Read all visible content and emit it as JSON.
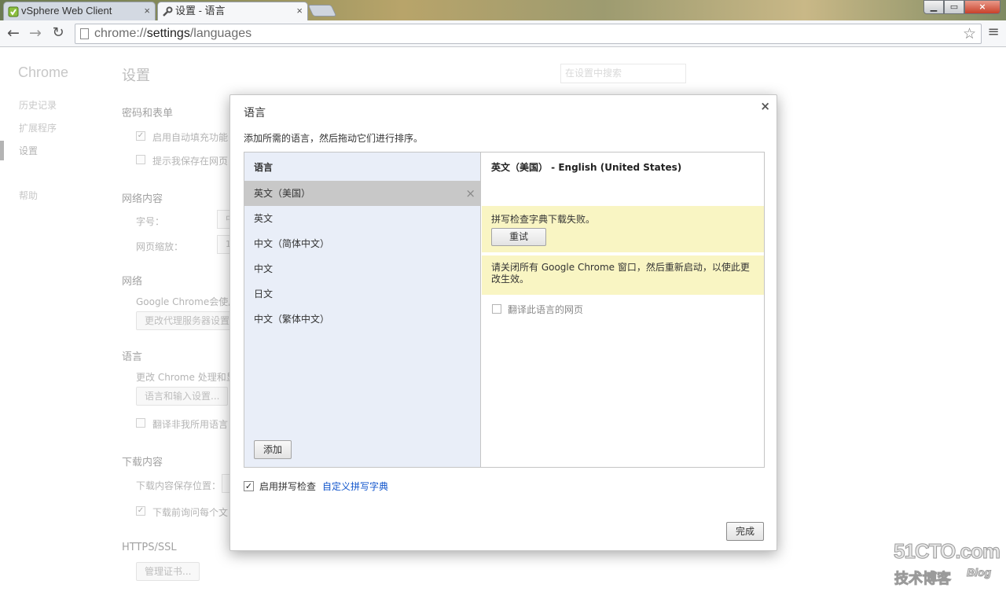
{
  "tabs": [
    {
      "title": "vSphere Web Client",
      "icon": "vsphere-icon",
      "close": "×"
    },
    {
      "title": "设置 - 语言",
      "icon": "wrench-icon",
      "close": "×"
    }
  ],
  "window": {
    "minimize": "▁",
    "maximize": "▭",
    "close": "×"
  },
  "toolbar": {
    "back": "←",
    "forward": "→",
    "reload": "↻",
    "url_scheme": "chrome://",
    "url_host": "settings",
    "url_path": "/languages",
    "star": "☆",
    "menu": "≡"
  },
  "sidebar": {
    "app_title": "Chrome",
    "items": [
      {
        "label": "历史记录"
      },
      {
        "label": "扩展程序"
      },
      {
        "label": "设置"
      },
      {
        "label": "帮助"
      }
    ]
  },
  "settings": {
    "title": "设置",
    "search_placeholder": "在设置中搜索",
    "passwords_title": "密码和表单",
    "autofill_label": "启用自动填充功能",
    "save_passwords_label": "提示我保存在网页",
    "web_content_title": "网络内容",
    "font_size_label": "字号：",
    "font_size_value": "中",
    "zoom_label": "网页缩放：",
    "zoom_value": "1",
    "network_title": "网络",
    "network_desc": "Google Chrome会使用",
    "proxy_button": "更改代理服务器设置",
    "languages_title": "语言",
    "languages_desc": "更改 Chrome 处理和显",
    "lang_input_button": "语言和输入设置...",
    "translate_label": "翻译非我所用语言",
    "downloads_title": "下载内容",
    "download_location_label": "下载内容保存位置：",
    "download_location_value": "D",
    "ask_download_label": "下载前询问每个文",
    "https_title": "HTTPS/SSL",
    "cert_button": "管理证书...",
    "check_mark": "✓"
  },
  "dialog": {
    "title": "语言",
    "close": "×",
    "description": "添加所需的语言，然后拖动它们进行排序。",
    "list_header": "语言",
    "languages": [
      {
        "label": "英文（美国）",
        "selected": true
      },
      {
        "label": "英文"
      },
      {
        "label": "中文（简体中文）"
      },
      {
        "label": "中文"
      },
      {
        "label": "日文"
      },
      {
        "label": "中文（繁体中文）"
      }
    ],
    "remove_icon": "×",
    "add_button": "添加",
    "detail_title": "英文（美国） - English (United States)",
    "spell_warning": "拼写检查字典下载失败。",
    "retry_button": "重试",
    "restart_notice": "请关闭所有 Google Chrome 窗口，然后重新启动，以使此更改生效。",
    "translate_label": "翻译此语言的网页",
    "spell_check_label": "启用拼写检查",
    "spell_check_mark": "✓",
    "custom_dict_link": "自定义拼写字典",
    "done_button": "完成"
  },
  "watermark": {
    "logo": "51CTO.com",
    "subtitle": "技术博客",
    "blog": "Blog"
  },
  "colors": {
    "warning_bg": "#f9f5c3",
    "list_bg": "#e9eef8",
    "selected_row": "#c8c8c8",
    "link": "#1155cc"
  }
}
